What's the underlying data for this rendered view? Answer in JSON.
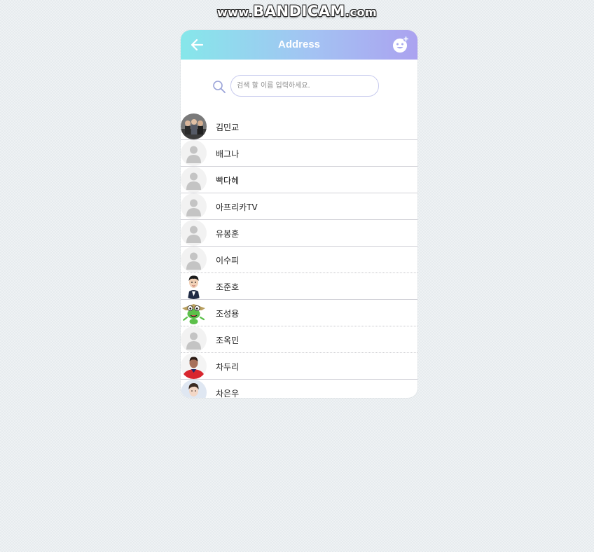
{
  "watermark": {
    "prefix": "www.",
    "brand": "BANDICAM",
    "suffix": ".com"
  },
  "header": {
    "title": "Address",
    "back_icon": "arrow-left-icon",
    "action_icon": "smiley-plus-icon",
    "gradient_start": "#86e7ea",
    "gradient_end": "#aba2f0"
  },
  "search": {
    "placeholder": "검색 할 이름 입력하세요.",
    "value": "",
    "icon": "search-icon"
  },
  "contacts": [
    {
      "name": "김민교",
      "avatar": "group-photo"
    },
    {
      "name": "배그나",
      "avatar": "default-person"
    },
    {
      "name": "빡다헤",
      "avatar": "default-person"
    },
    {
      "name": "아프리카TV",
      "avatar": "default-person"
    },
    {
      "name": "유봉훈",
      "avatar": "default-person"
    },
    {
      "name": "이수피",
      "avatar": "default-person"
    },
    {
      "name": "조준호",
      "avatar": "cartoon-man-suit"
    },
    {
      "name": "조성용",
      "avatar": "green-frog-character"
    },
    {
      "name": "조옥민",
      "avatar": "default-person"
    },
    {
      "name": "차두리",
      "avatar": "soccer-player-red"
    },
    {
      "name": "차은우",
      "avatar": "young-man-portrait"
    }
  ]
}
